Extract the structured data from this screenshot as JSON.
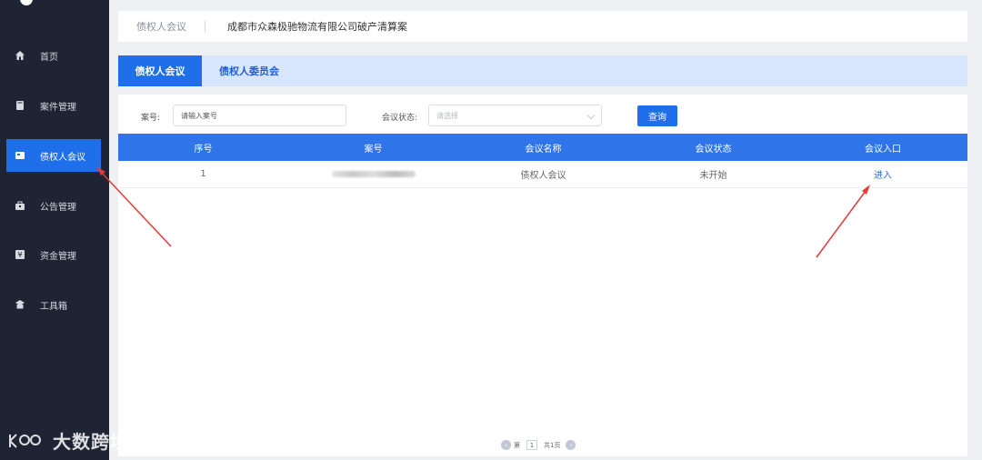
{
  "sidebar": {
    "items": [
      {
        "label": "首页",
        "icon": "home-icon"
      },
      {
        "label": "案件管理",
        "icon": "book-icon"
      },
      {
        "label": "债权人会议",
        "icon": "meeting-icon"
      },
      {
        "label": "公告管理",
        "icon": "briefcase-icon"
      },
      {
        "label": "资金管理",
        "icon": "money-icon"
      },
      {
        "label": "工具箱",
        "icon": "toolbox-icon"
      }
    ],
    "active_index": 2,
    "bg_color": "#1f2434",
    "active_color": "#1f6feb"
  },
  "header": {
    "breadcrumb": "债权人会议",
    "case_title": "成都市众森极驰物流有限公司破产清算案"
  },
  "tabs": [
    {
      "label": "债权人会议",
      "active": true
    },
    {
      "label": "债权人委员会",
      "active": false
    }
  ],
  "filters": {
    "case_no_label": "案号:",
    "case_no_placeholder": "请输入案号",
    "status_label": "会议状态:",
    "status_placeholder": "请选择",
    "query_button": "查询"
  },
  "table": {
    "columns": [
      "序号",
      "案号",
      "会议名称",
      "会议状态",
      "会议入口"
    ],
    "rows": [
      {
        "index": "1",
        "case_no": "",
        "meeting_name": "债权人会议",
        "status": "未开始",
        "entry": "进入"
      }
    ]
  },
  "pagination": {
    "prefix": "第",
    "current_page": "1",
    "total": "共1页"
  },
  "watermark": {
    "text": "大数跨境"
  }
}
